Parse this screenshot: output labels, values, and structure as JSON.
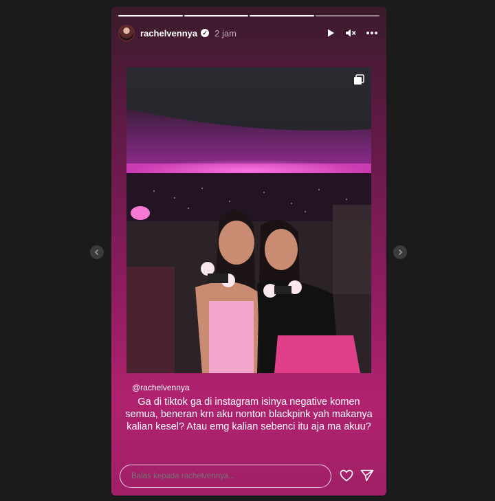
{
  "story": {
    "segments_total": 4,
    "segments_done": 3,
    "username": "rachelvennya",
    "time_ago": "2 jam",
    "mention": "@rachelvennya",
    "caption": "Ga di tiktok ga di instagram isinya negative komen semua, beneran krn aku nonton blackpink yah makanya kalian kesel? Atau emg kalian sebenci itu aja ma akuu?",
    "reply_placeholder": "Balas kepada rachelvennya..."
  },
  "icons": {
    "play": "play-icon",
    "mute": "mute-icon",
    "more": "more-icon",
    "verified": "verified-badge-icon",
    "heart": "heart-icon",
    "send": "send-icon",
    "multi": "multiple-media-icon",
    "prev": "chevron-left-icon",
    "next": "chevron-right-icon"
  },
  "colors": {
    "page_bg": "#1b1b1b",
    "story_top": "#3a1b2b",
    "story_bottom": "#b0226f",
    "stage_pink": "#e640c8"
  }
}
